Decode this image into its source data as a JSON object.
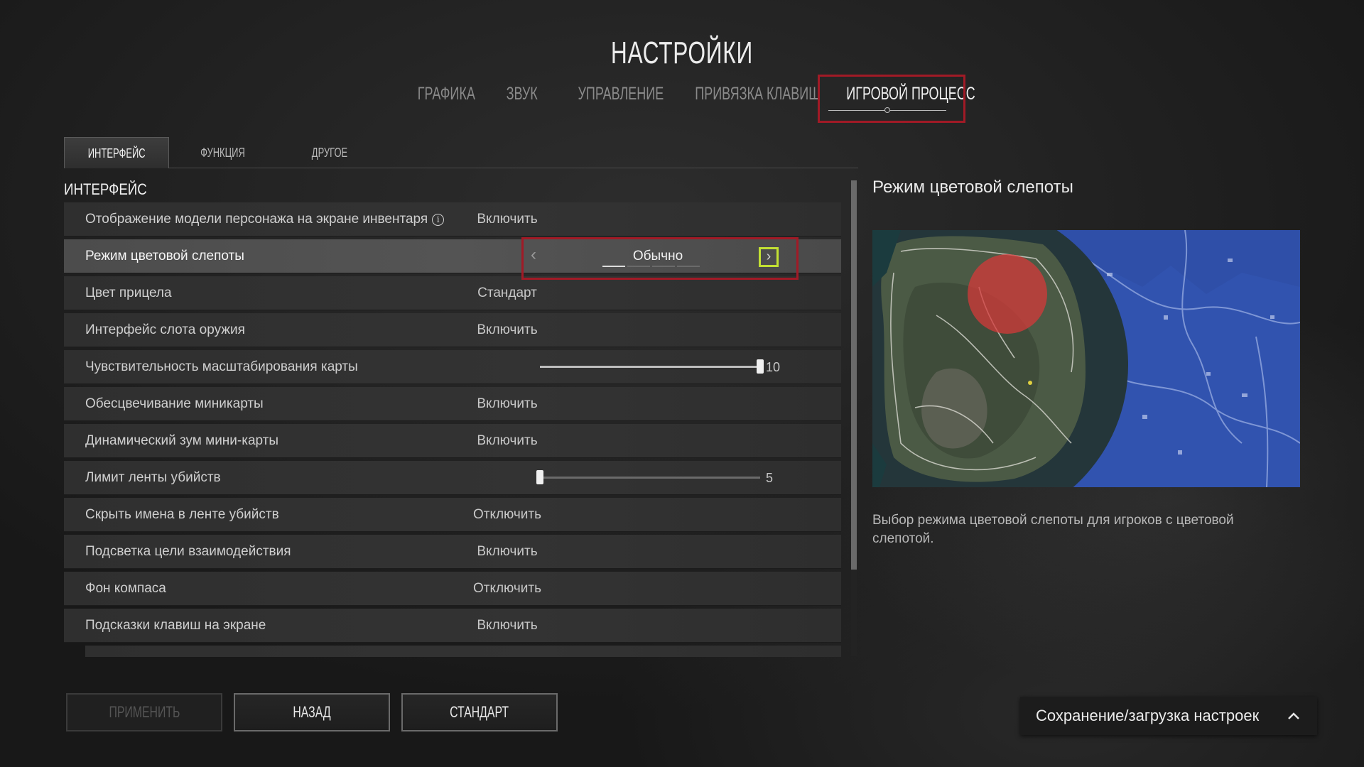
{
  "page_title": "НАСТРОЙКИ",
  "main_tabs": [
    {
      "label": "ГРАФИКА"
    },
    {
      "label": "ЗВУК"
    },
    {
      "label": "УПРАВЛЕНИЕ"
    },
    {
      "label": "ПРИВЯЗКА КЛАВИШ"
    },
    {
      "label": "ИГРОВОЙ ПРОЦЕСС",
      "active": true
    }
  ],
  "sub_tabs": [
    {
      "label": "ИНТЕРФЕЙС",
      "active": true
    },
    {
      "label": "ФУНКЦИЯ"
    },
    {
      "label": "ДРУГОЕ"
    }
  ],
  "section_title": "ИНТЕРФЕЙС",
  "settings": [
    {
      "label": "Отображение модели персонажа на экране инвентаря",
      "value": "Включить",
      "info": true
    },
    {
      "label": "Режим цветовой слепоты",
      "value": "Обычно",
      "selected": true,
      "options_count": 4,
      "option_index": 0
    },
    {
      "label": "Цвет прицела",
      "value": "Стандарт"
    },
    {
      "label": "Интерфейс слота оружия",
      "value": "Включить"
    },
    {
      "label": "Чувствительность масштабирования карты",
      "slider_value": "10",
      "slider_fraction": 1.0
    },
    {
      "label": "Обесцвечивание миникарты",
      "value": "Включить"
    },
    {
      "label": "Динамический зум мини-карты",
      "value": "Включить"
    },
    {
      "label": "Лимит ленты убийств",
      "slider_value": "5",
      "slider_fraction": 0.0
    },
    {
      "label": "Скрыть имена в ленте убийств",
      "value": "Отключить"
    },
    {
      "label": "Подсветка цели взаимодействия",
      "value": "Включить"
    },
    {
      "label": "Фон компаса",
      "value": "Отключить"
    },
    {
      "label": "Подсказки клавиш на экране",
      "value": "Включить"
    }
  ],
  "selector_prev_glyph": "‹",
  "selector_next_glyph": "›",
  "info_glyph": "i",
  "detail": {
    "title": "Режим цветовой слепоты",
    "description": "Выбор режима цветовой слепоты для игроков с цветовой слепотой."
  },
  "buttons": {
    "apply": "ПРИМЕНИТЬ",
    "back": "НАЗАД",
    "default": "СТАНДАРТ"
  },
  "saveload": {
    "label": "Сохранение/загрузка настроек"
  },
  "colors": {
    "highlight_red": "#a11a26",
    "focus_green": "#c2e033",
    "map_blue": "#2f4fa8",
    "map_red_zone": "#d43a3a"
  },
  "icons": [
    "info-icon",
    "chevron-left-icon",
    "chevron-right-icon",
    "chevron-up-icon"
  ]
}
